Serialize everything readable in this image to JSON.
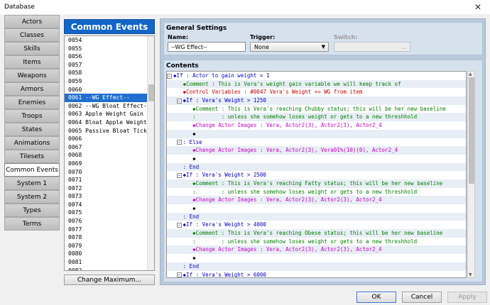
{
  "window": {
    "title": "Database",
    "close_glyph": "✕"
  },
  "categories": [
    "Actors",
    "Classes",
    "Skills",
    "Items",
    "Weapons",
    "Armors",
    "Enemies",
    "Troops",
    "States",
    "Animations",
    "Tilesets",
    "Common Events",
    "System 1",
    "System 2",
    "Types",
    "Terms"
  ],
  "selected_category": "Common Events",
  "list_header": "Common Events",
  "events": [
    "0054",
    "0055",
    "0056",
    "0057",
    "0058",
    "0059",
    "0060",
    "0061 --WG Effect--",
    "0062 --WG Bloat Effect--",
    "0063 Apple Weight Gain E…",
    "0064 Bloat Apple Weight …",
    "0065 Passive Bloat Ticker",
    "0066",
    "0067",
    "0068",
    "0069",
    "0070",
    "0071",
    "0072",
    "0073",
    "0074",
    "0075",
    "0076",
    "0077",
    "0078",
    "0079",
    "0080",
    "0081",
    "0082"
  ],
  "selected_event": "0061 --WG Effect--",
  "change_max_label": "Change Maximum...",
  "general": {
    "title": "General Settings",
    "name_label": "Name:",
    "name_value": "--WG Effect--",
    "trigger_label": "Trigger:",
    "trigger_value": "None",
    "switch_label": "Switch:",
    "switch_value": "..."
  },
  "contents_title": "Contents",
  "commands": [
    {
      "text": "◆If : Actor to gain weight = 1",
      "kind": "if",
      "toggle": "−"
    },
    {
      "text": "   ◆Comment : This is Vera's weight gain variable we will keep track of",
      "kind": "com"
    },
    {
      "text": "   ◆Control Variables : #0047 Vera's Weight += WG from item",
      "kind": "var"
    },
    {
      "text": "◆If : Vera's Weight > 1250",
      "kind": "if",
      "toggle": "−",
      "indent": 1
    },
    {
      "text": "      ◆Comment : This is Vera's reaching Chubby status; this will be her new baseline",
      "kind": "com"
    },
    {
      "text": "      :        : unless she somehow loses weight or gets to a new threshhold",
      "kind": "com"
    },
    {
      "text": "      ◆Change Actor Images : Vera, Actor2(3), Actor2(3), Actor2_4",
      "kind": "img"
    },
    {
      "text": "      ◆",
      "kind": "blk"
    },
    {
      "text": ": Else",
      "kind": "if",
      "toggle": "−",
      "indent": 1
    },
    {
      "text": "      ◆Change Actor Images : Vera, Actor2(3), Vera01%(10)(0), Actor2_4",
      "kind": "img"
    },
    {
      "text": "      ◆",
      "kind": "blk"
    },
    {
      "text": "   : End",
      "kind": "if"
    },
    {
      "text": "◆If : Vera's Weight > 2500",
      "kind": "if",
      "toggle": "−",
      "indent": 1
    },
    {
      "text": "      ◆Comment : This is Vera's reaching Fatty status; this will be her new baseline",
      "kind": "com"
    },
    {
      "text": "      :        : unless she somehow loses weight or gets to a new threshhold",
      "kind": "com"
    },
    {
      "text": "      ◆Change Actor Images : Vera, Actor2(3), Actor2(3), Actor2_4",
      "kind": "img"
    },
    {
      "text": "      ◆",
      "kind": "blk"
    },
    {
      "text": "   : End",
      "kind": "if"
    },
    {
      "text": "◆If : Vera's Weight > 4000",
      "kind": "if",
      "toggle": "−",
      "indent": 1
    },
    {
      "text": "      ◆Comment : This is Vera's reaching Obese status; this will be her new baseline",
      "kind": "com"
    },
    {
      "text": "      :        : unless she somehow loses weight or gets to a new threshhold",
      "kind": "com"
    },
    {
      "text": "      ◆Change Actor Images : Vera, Actor2(3), Actor2(3), Actor2_4",
      "kind": "img"
    },
    {
      "text": "      ◆",
      "kind": "blk"
    },
    {
      "text": "   : End",
      "kind": "if"
    },
    {
      "text": "◆If : Vera's Weight > 6000",
      "kind": "if",
      "toggle": "−",
      "indent": 1
    }
  ],
  "buttons": {
    "ok": "OK",
    "cancel": "Cancel",
    "apply": "Apply"
  }
}
